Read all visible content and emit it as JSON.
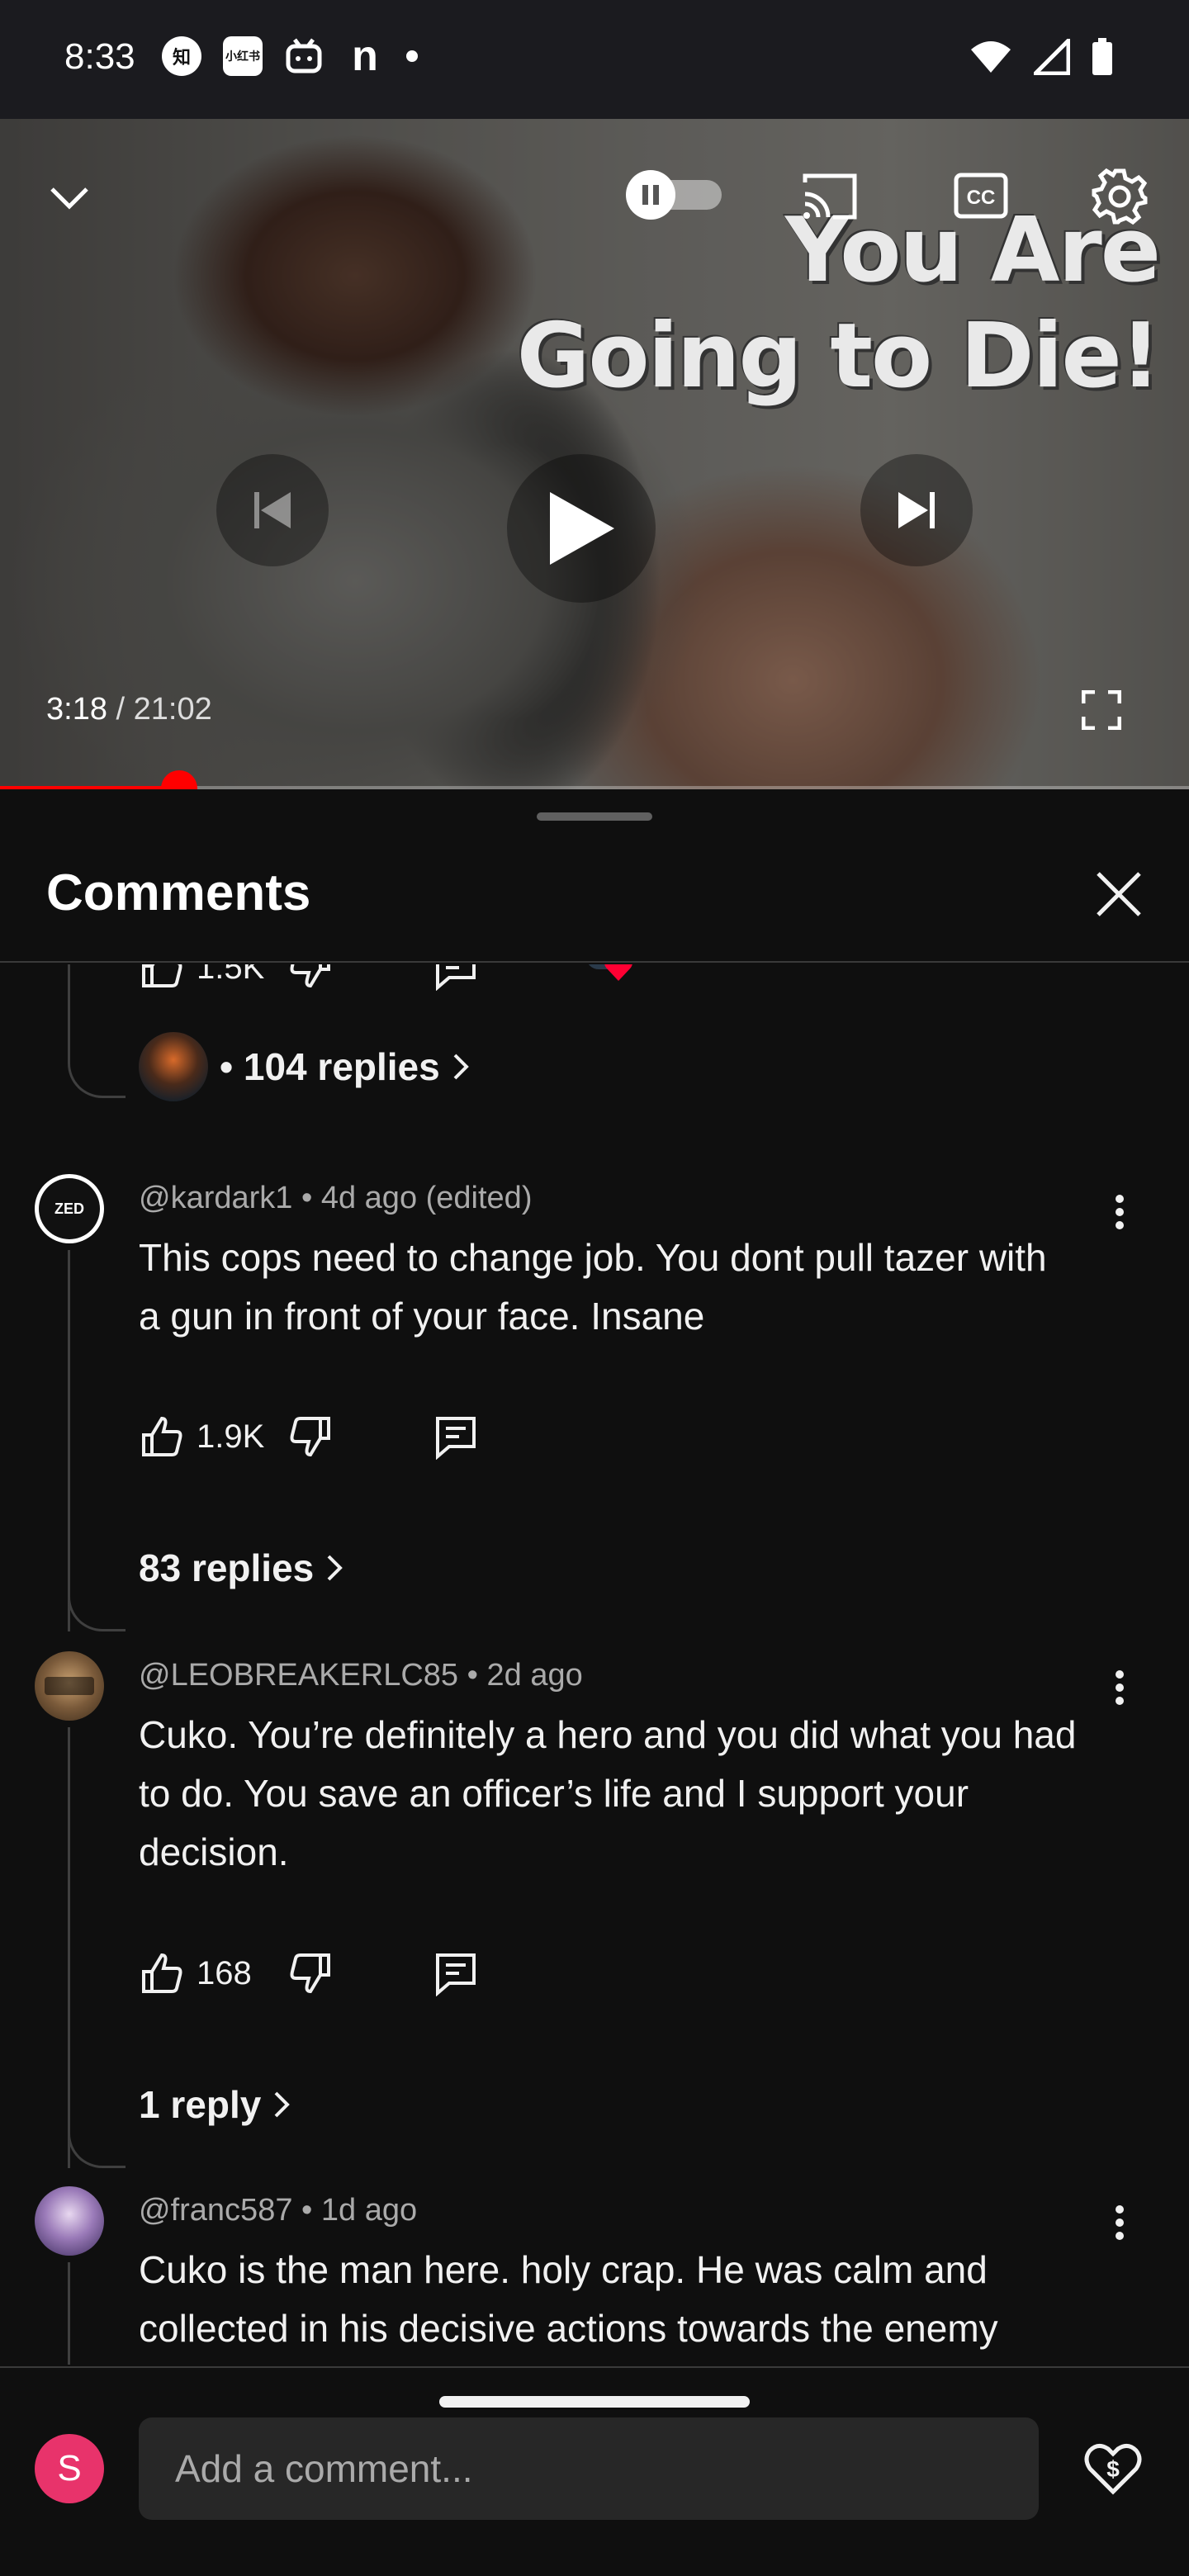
{
  "status_bar": {
    "time": "8:33",
    "app_icons": [
      "知",
      "小红书",
      "bilibili",
      "n"
    ]
  },
  "player": {
    "thumbnail_title": "You Are Going to Die!",
    "current_time": "3:18",
    "duration": "21:02",
    "progress": 0.151,
    "autoplay_state": "paused",
    "accent_color": "#ff0000"
  },
  "comments_panel": {
    "title": "Comments",
    "partial_top": {
      "like_count": "1.5K",
      "replies_label": "• 104 replies"
    },
    "comments": [
      {
        "author": "@kardark1",
        "meta": "• 4d ago (edited)",
        "text": "This cops need to change job. You dont pull tazer with a gun in front of your face. Insane",
        "likes": "1.9K",
        "replies_label": "83 replies",
        "avatar_text": "ZED"
      },
      {
        "author": "@LEOBREAKERLC85",
        "meta": "• 2d ago",
        "text": "Cuko. You’re definitely a hero and you did what you had to do. You save an officer’s life and I support your decision.",
        "likes": "168",
        "replies_label": "1 reply"
      },
      {
        "author": "@franc587",
        "meta": "• 1d ago",
        "text": "Cuko is the man here. holy crap. He was calm and collected in his decisive actions towards the enemy"
      }
    ]
  },
  "composer": {
    "user_initial": "S",
    "placeholder": "Add a comment..."
  }
}
